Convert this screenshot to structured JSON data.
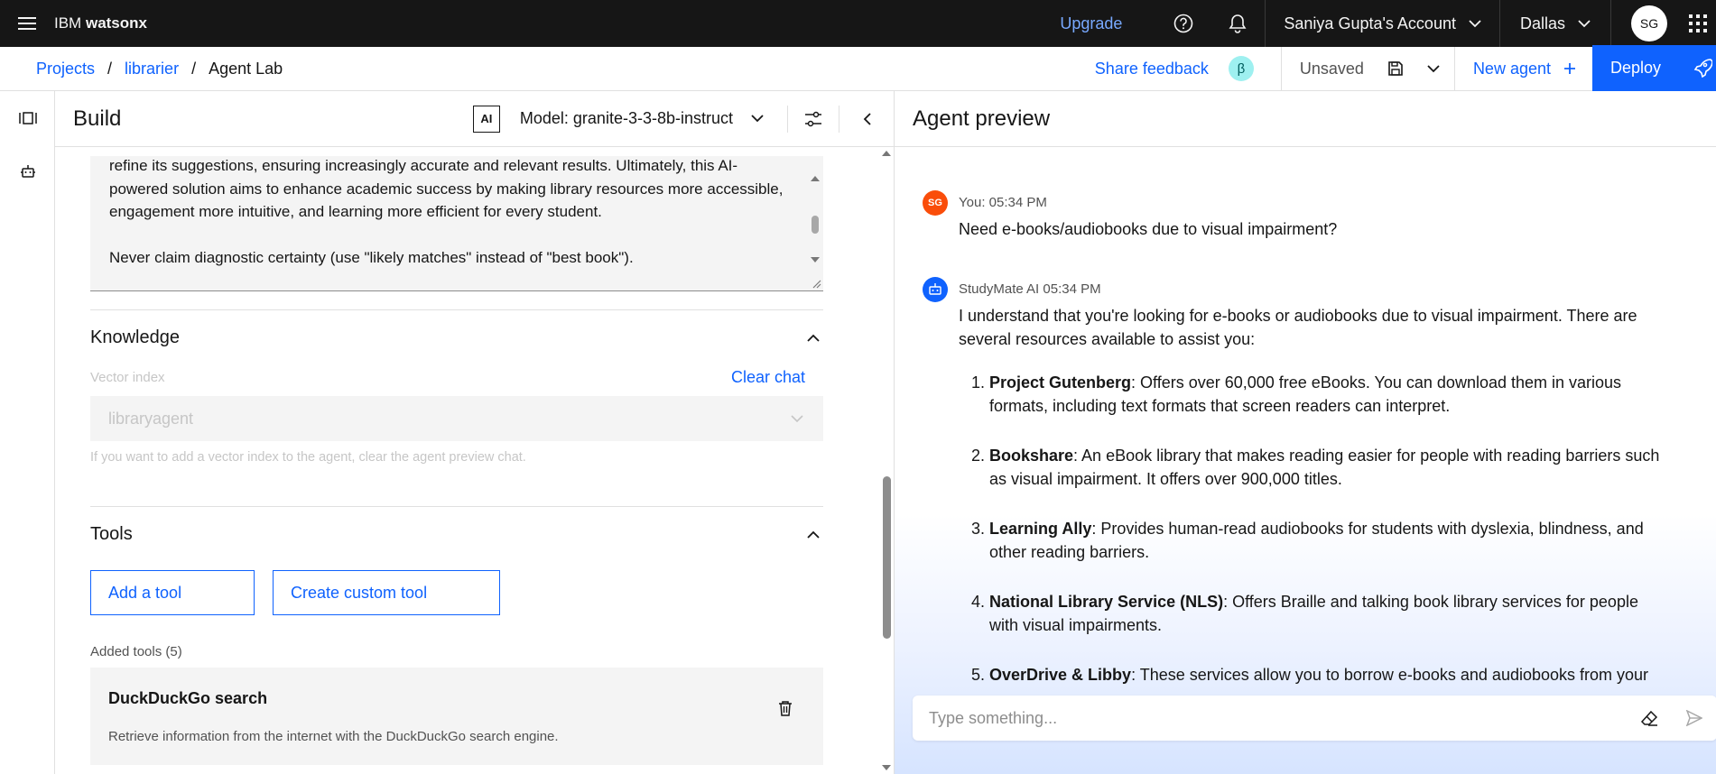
{
  "header": {
    "brand_prefix": "IBM",
    "brand_product": "watsonx",
    "upgrade": "Upgrade",
    "account": "Saniya Gupta's Account",
    "region": "Dallas",
    "avatar_initials": "SG",
    "icons": [
      "menu-icon",
      "help-icon",
      "notification-icon",
      "chevron-down-icon",
      "app-switcher-icon"
    ]
  },
  "subheader": {
    "breadcrumb": [
      "Projects",
      "librarier",
      "Agent Lab"
    ],
    "separator": "/",
    "share_feedback": "Share feedback",
    "beta": "β",
    "unsaved": "Unsaved",
    "new_agent": "New agent",
    "deploy": "Deploy"
  },
  "build": {
    "title": "Build",
    "ai_badge": "AI",
    "model": "Model: granite-3-3-8b-instruct",
    "instructions": [
      "refine its suggestions, ensuring increasingly accurate and relevant results. Ultimately, this AI-powered solution aims to enhance academic success by making library resources more accessible, engagement more intuitive, and learning more efficient for every student.",
      "Never claim diagnostic certainty (use \"likely matches\" instead of \"best book\")."
    ],
    "knowledge": {
      "title": "Knowledge",
      "vector_label": "Vector index",
      "clear_chat": "Clear chat",
      "vector_value": "libraryagent",
      "helper": "If you want to add a vector index to the agent, clear the agent preview chat."
    },
    "tools": {
      "title": "Tools",
      "add_tool": "Add a tool",
      "create_tool": "Create custom tool",
      "added_label": "Added tools (5)",
      "items": [
        {
          "name": "DuckDuckGo search",
          "description": "Retrieve information from the internet with the DuckDuckGo search engine."
        }
      ]
    }
  },
  "preview": {
    "title": "Agent preview",
    "messages": [
      {
        "initials": "SG",
        "meta": "You: 05:34 PM",
        "text": "Need e-books/audiobooks due to visual impairment?"
      },
      {
        "meta": "StudyMate AI 05:34 PM",
        "text": "I understand that you're looking for e-books or audiobooks due to visual impairment. There are several resources available to assist you:"
      }
    ],
    "list": [
      {
        "n": "1.",
        "bold": "Project Gutenberg",
        "rest": ": Offers over 60,000 free eBooks. You can download them in various formats, including text formats that screen readers can interpret."
      },
      {
        "n": "2.",
        "bold": "Bookshare",
        "rest": ": An eBook library that makes reading easier for people with reading barriers such as visual impairment. It offers over 900,000 titles."
      },
      {
        "n": "3.",
        "bold": "Learning Ally",
        "rest": ": Provides human-read audiobooks for students with dyslexia, blindness, and other reading barriers."
      },
      {
        "n": "4.",
        "bold": "National Library Service (NLS)",
        "rest": ": Offers Braille and talking book library services for people with visual impairments."
      },
      {
        "n": "5.",
        "bold": "OverDrive & Libby",
        "rest": ": These services allow you to borrow e-books and audiobooks from your"
      }
    ],
    "composer_placeholder": "Type something..."
  },
  "colors": {
    "brand_blue": "#0f62fe",
    "header_bg": "#161616",
    "user_avatar": "#fa4d0a",
    "agent_avatar": "#0f62fe"
  }
}
